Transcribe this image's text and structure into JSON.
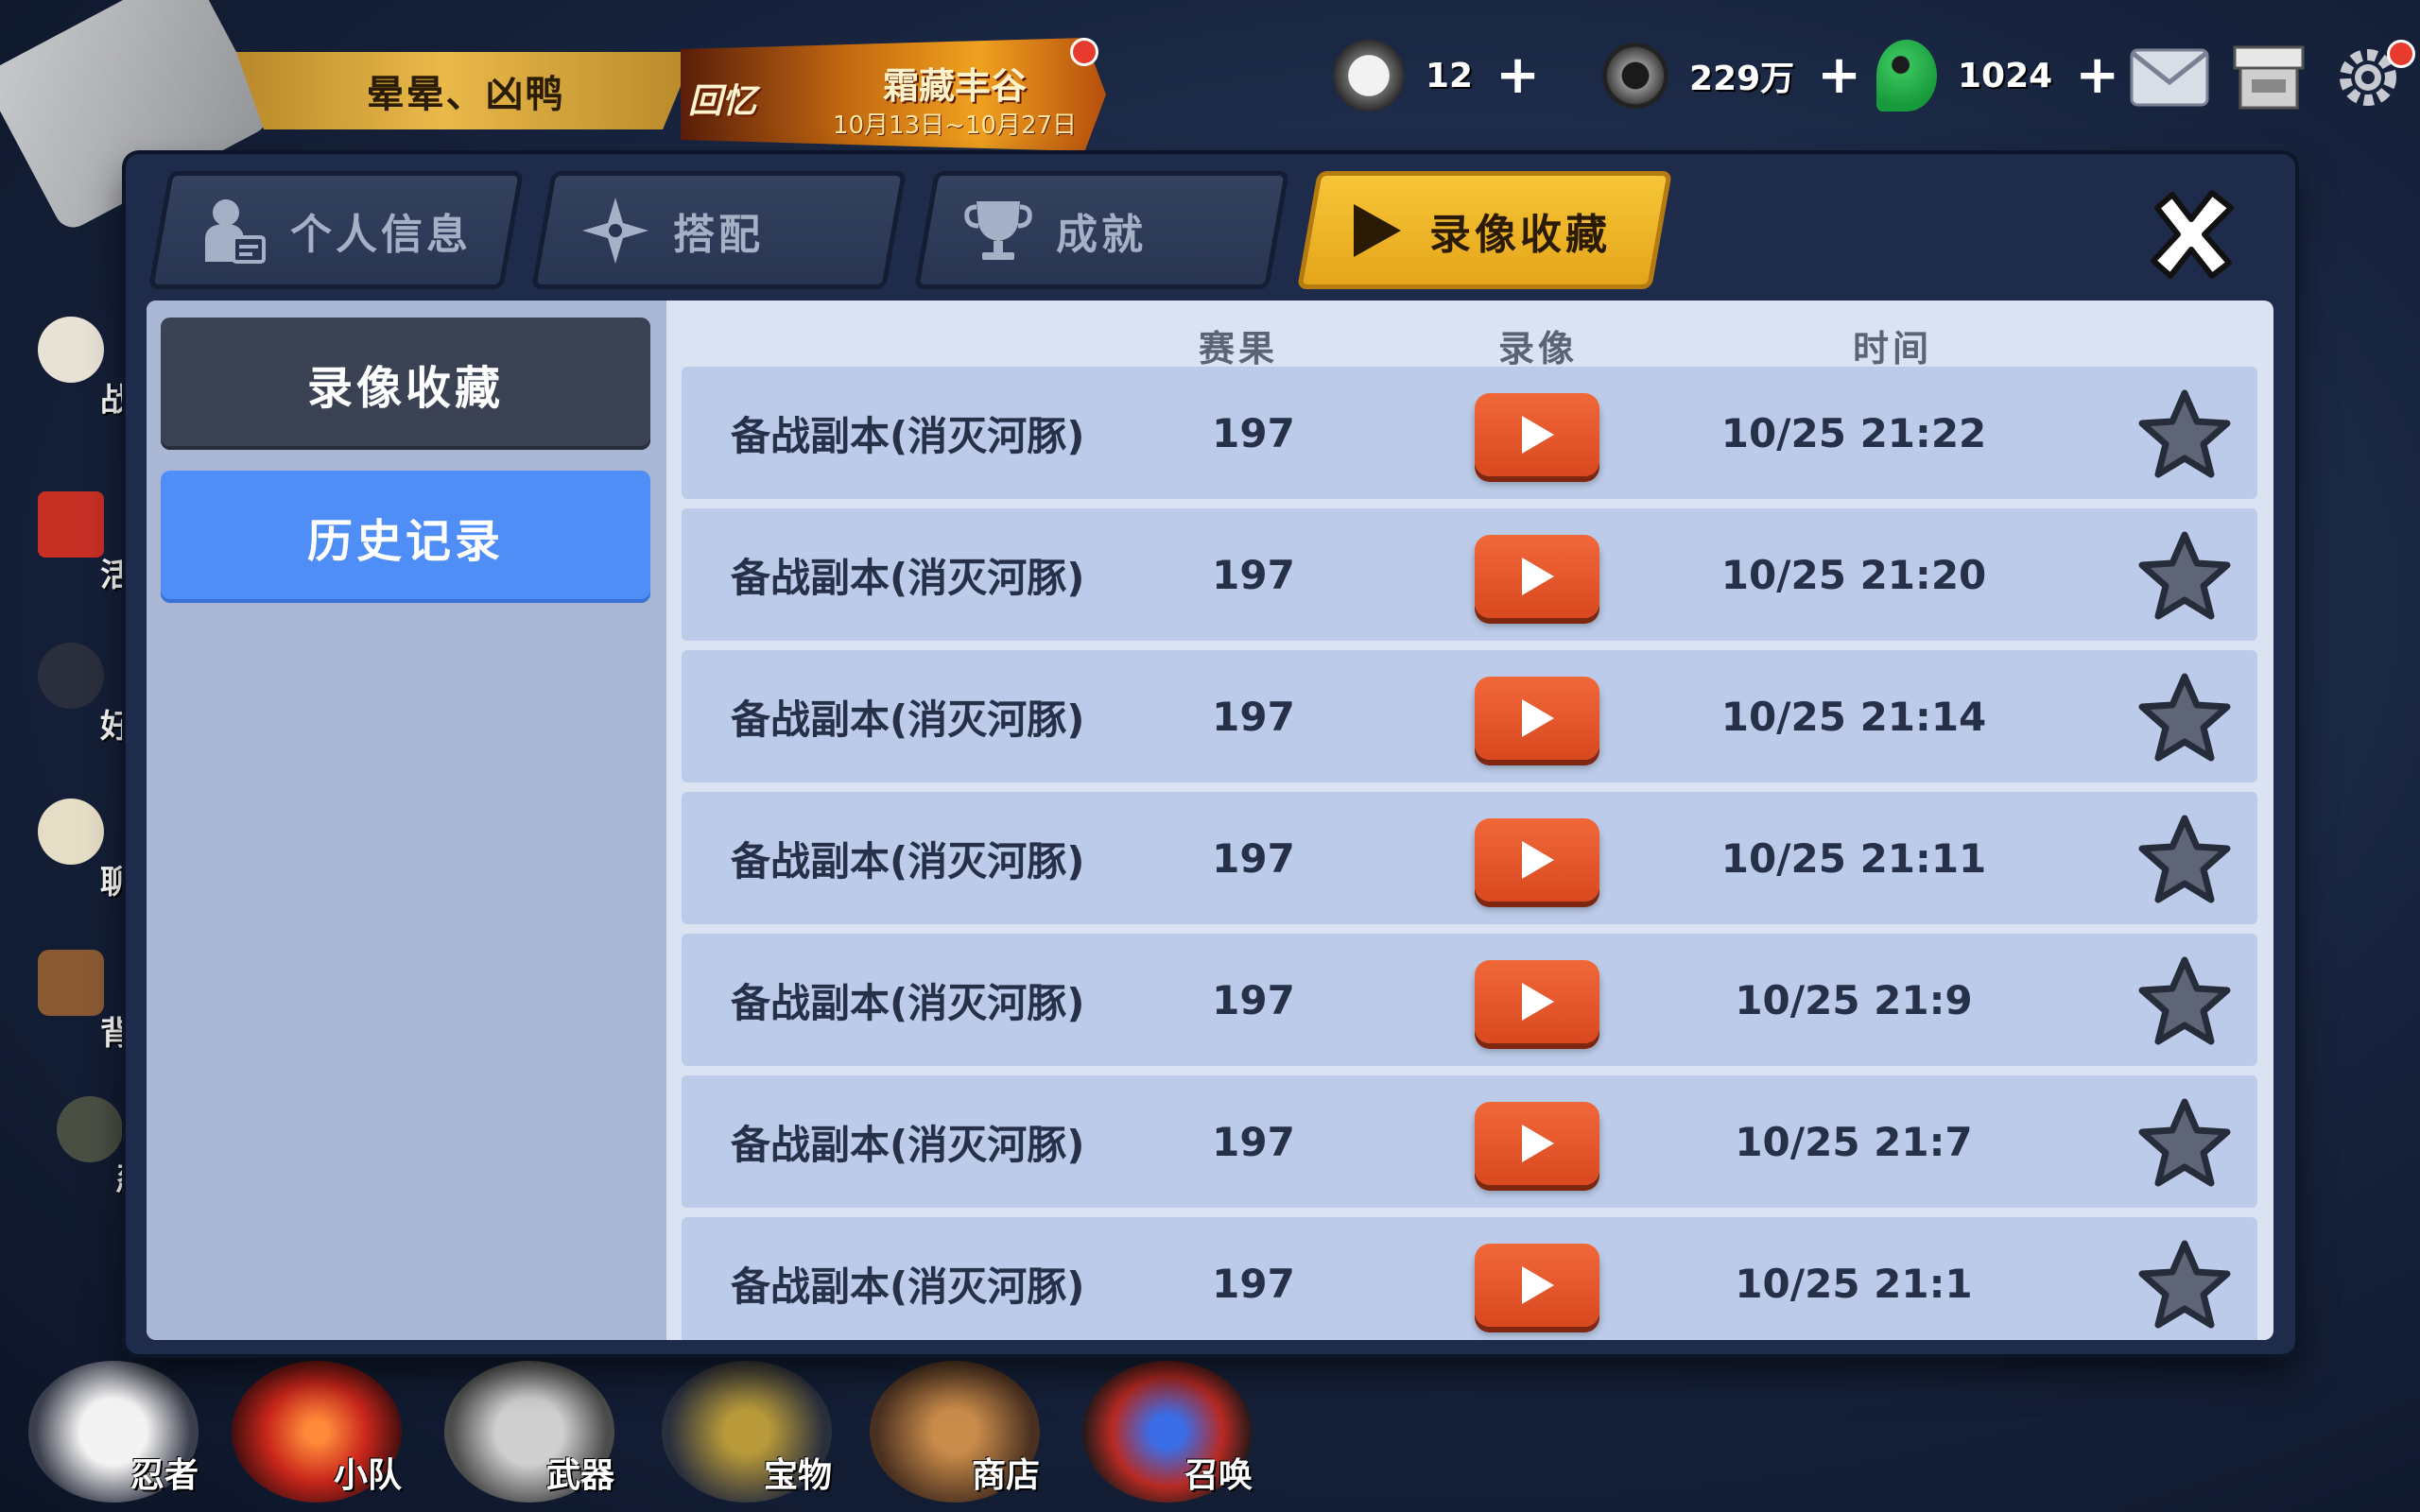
{
  "hud": {
    "player_name": "晕晕、凶鸭",
    "event": {
      "tag": "回忆",
      "title": "霜藏丰谷",
      "date": "10月13日~10月27日"
    },
    "resources": [
      {
        "icon": "onigiri-icon",
        "value": "12"
      },
      {
        "icon": "coin-icon",
        "value": "229万"
      },
      {
        "icon": "jade-icon",
        "value": "1024"
      }
    ],
    "plus": "+"
  },
  "side_menu": [
    "战",
    "活",
    "好",
    "聊",
    "背",
    "忍者"
  ],
  "bottom_nav": [
    "忍者",
    "小队",
    "武器",
    "宝物",
    "商店",
    "召唤"
  ],
  "tabs": [
    {
      "label": "个人信息",
      "icon": "profile-icon",
      "active": false
    },
    {
      "label": "搭配",
      "icon": "shuriken-icon",
      "active": false
    },
    {
      "label": "成就",
      "icon": "trophy-icon",
      "active": false
    },
    {
      "label": "录像收藏",
      "icon": "play-icon",
      "active": true
    }
  ],
  "left_menu": {
    "favorites": "录像收藏",
    "history": "历史记录"
  },
  "columns": {
    "result": "赛果",
    "replay": "录像",
    "time": "时间"
  },
  "rows": [
    {
      "name": "备战副本(消灭河豚)",
      "score": "197",
      "time": "10/25 21:22"
    },
    {
      "name": "备战副本(消灭河豚)",
      "score": "197",
      "time": "10/25 21:20"
    },
    {
      "name": "备战副本(消灭河豚)",
      "score": "197",
      "time": "10/25 21:14"
    },
    {
      "name": "备战副本(消灭河豚)",
      "score": "197",
      "time": "10/25 21:11"
    },
    {
      "name": "备战副本(消灭河豚)",
      "score": "197",
      "time": "10/25 21:9"
    },
    {
      "name": "备战副本(消灭河豚)",
      "score": "197",
      "time": "10/25 21:7"
    },
    {
      "name": "备战副本(消灭河豚)",
      "score": "197",
      "time": "10/25 21:1"
    }
  ],
  "colors": {
    "accent": "#f6c537",
    "play": "#e5572a",
    "history": "#4f8ef7"
  }
}
